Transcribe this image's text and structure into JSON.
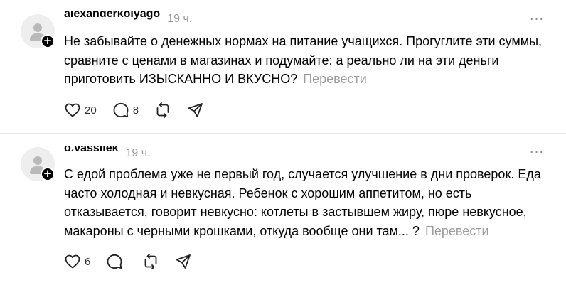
{
  "posts": [
    {
      "username": "alexanderkolyago",
      "timestamp": "19 ч.",
      "text": "Не забывайте о денежных нормах на питание учащихся. Прогуглите эти суммы, сравните с ценами в магазинах и подумайте: а реально ли на эти деньги приготовить ИЗЫСКАННО И ВКУСНО?",
      "translate_label": "Перевести",
      "likes": "20",
      "replies": "8",
      "follow_badge": "+",
      "more": "···"
    },
    {
      "username": "o.vassilek",
      "timestamp": "19 ч.",
      "text": "С едой проблема уже не первый год, случается улучшение в дни проверок. Еда часто холодная и невкусная. Ребенок с хорошим аппетитом, но есть отказывается, говорит невкусно: котлеты в застывшем жиру, пюре невкусное, макароны с черными крошками, откуда вообще они там... ?",
      "translate_label": "Перевести",
      "likes": "6",
      "replies": "",
      "follow_badge": "+",
      "more": "···"
    }
  ],
  "colors": {
    "muted": "#9b9b9b",
    "text": "#000000",
    "divider": "#e5e5e5",
    "avatar_bg": "#eeeeee"
  },
  "icons": [
    "heart-icon",
    "comment-icon",
    "repost-icon",
    "share-icon",
    "more-icon",
    "plus-icon",
    "user-placeholder-icon"
  ]
}
